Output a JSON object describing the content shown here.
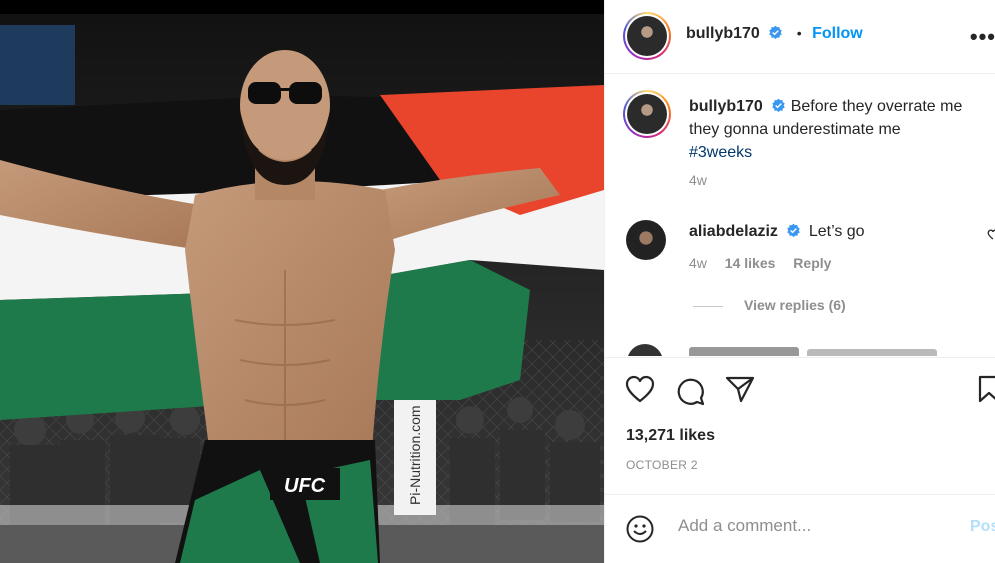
{
  "post": {
    "author": "bullyb170",
    "follow_label": "Follow",
    "separator": "•",
    "more_label": "•••",
    "caption_text": "Before they overrate me they gonna underestimate me",
    "hashtag": "#3weeks",
    "caption_time": "4w"
  },
  "comments": [
    {
      "user": "aliabdelaziz",
      "text": "Let’s go",
      "time": "4w",
      "likes": "14 likes",
      "reply_label": "Reply",
      "view_replies": "View replies (6)"
    }
  ],
  "engagement": {
    "likes": "13,271 likes",
    "date": "OCTOBER 2"
  },
  "comment_box": {
    "placeholder": "Add a comment...",
    "post_label": "Post"
  },
  "photo": {
    "shorts_logo": "UFC",
    "banner_text": "Pi-Nutrition.com"
  },
  "colors": {
    "accent": "#0095f6",
    "hashtag": "#00376b",
    "muted": "#8e8e8e",
    "flag_red": "#e8452c",
    "flag_green": "#1f7a4b",
    "verified": "#3897f0"
  }
}
